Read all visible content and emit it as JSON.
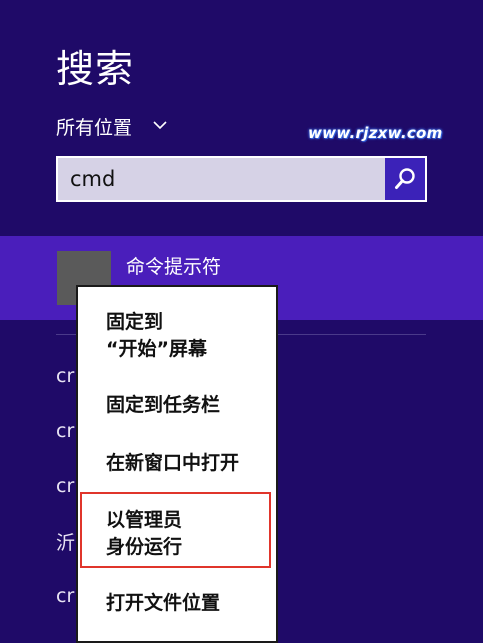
{
  "search": {
    "title": "搜索",
    "scope_label": "所有位置",
    "query": "cmd",
    "watermark": "www.rjzxw.com"
  },
  "results": {
    "selected_label": "命令提示符",
    "partial_items": [
      "cr",
      "cr",
      "cr",
      "沂",
      "cr"
    ]
  },
  "context_menu": {
    "items": [
      "固定到\n“开始”屏幕",
      "固定到任务栏",
      "在新窗口中打开",
      "以管理员\n身份运行",
      "打开文件位置"
    ]
  },
  "colors": {
    "background": "#1f0a68",
    "selected_row": "#4a1ebb",
    "search_button": "#3b22b8",
    "highlight_border": "#e0352b"
  },
  "icons": {
    "scope": "chevron-down-icon",
    "search": "magnifier-icon"
  }
}
